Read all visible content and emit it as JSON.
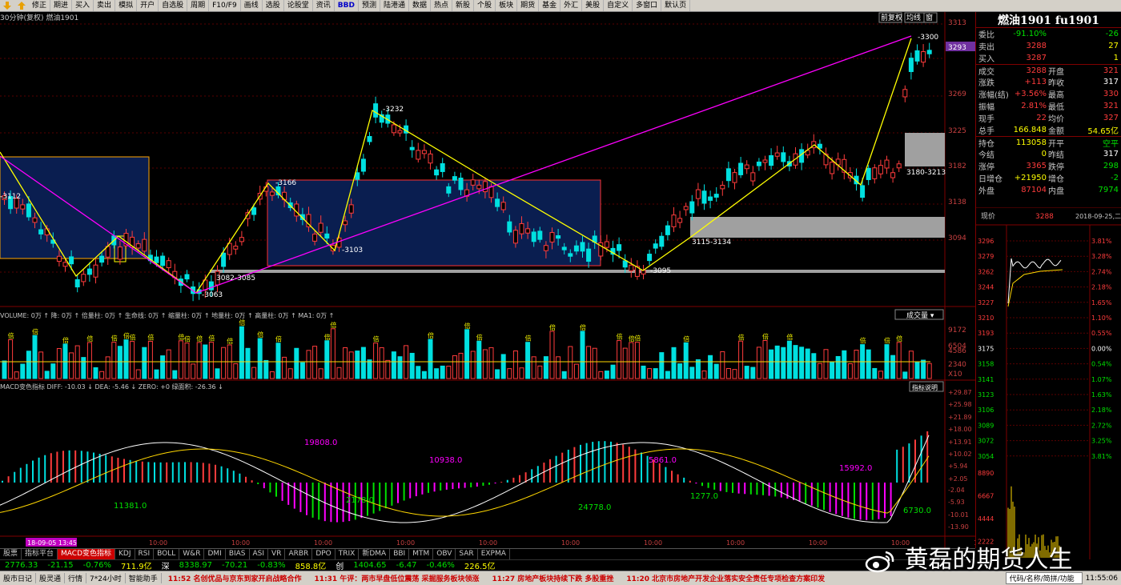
{
  "toolbar": {
    "items": [
      "修正",
      "期进",
      "买入",
      "卖出",
      "模拟",
      "开户",
      "自选股",
      "周期",
      "F10/F9",
      "画线",
      "选股",
      "论股堂",
      "资讯",
      "BBD",
      "预测",
      "陆港通",
      "数据",
      "热点",
      "新股",
      "个股",
      "板块",
      "期货",
      "基金",
      "外汇",
      "美股",
      "自定义",
      "多窗口",
      "默认页"
    ],
    "highlight_index": 13
  },
  "chart_header": {
    "period": "30分钟(复权)",
    "symbol": "燃油1901",
    "buttons": [
      "前复权",
      "均线",
      "窗"
    ]
  },
  "price_labels": {
    "axis": [
      "3313",
      "3293",
      "3269",
      "3225",
      "3182",
      "3138",
      "3094"
    ],
    "current": "3293",
    "peaks": [
      "3300",
      "3232",
      "3166",
      "3112",
      "3103",
      "3063",
      "3095"
    ],
    "zones": [
      "3082-3085",
      "3115-3134",
      "3180-3213"
    ]
  },
  "volume_panel": {
    "legend": "VOLUME: 0万 ↑ 降: 0万 ↑ 倍量柱: 0万 ↑ 生命线: 0万 ↑ 缩量柱: 0万 ↑ 地量柱: 0万 ↑ 高量柱: 0万 ↑ MA1: 0万 ↑",
    "selector": "成交量",
    "axis": [
      "9172",
      "6504",
      "4586",
      "2340",
      "X10"
    ],
    "mark": "倍"
  },
  "macd_panel": {
    "legend": "MACD变色指标  DIFF: -10.03 ↓  DEA: -5.46 ↓  ZERO: +0  绿面积: -26.36 ↓",
    "help": "指标说明",
    "axis": [
      "+29.87",
      "+25.98",
      "+21.89",
      "+18.00",
      "+13.91",
      "+10.02",
      "+5.94",
      "+2.05",
      "-2.04",
      "-5.93",
      "-10.01",
      "-13.90"
    ],
    "areas": [
      "19808.0",
      "10938.0",
      "5861.0",
      "15992.0",
      "11381.0",
      "2178.0",
      "24778.0",
      "1277.0",
      "6730.0"
    ]
  },
  "time_axis": {
    "start": "18-09-05 13:45",
    "ticks": [
      "10:00",
      "10:00",
      "10:00",
      "10:00",
      "10:00",
      "10:00",
      "10:00",
      "10:00",
      "10:00",
      "10:00",
      "10:00",
      "10:00"
    ]
  },
  "quote_panel": {
    "title": "燃油1901 fu1901",
    "rows": [
      {
        "l1": "委比",
        "v1": "-91.10%",
        "c1": "grn",
        "l2": "",
        "v2": "-26",
        "c2": "grn"
      },
      {
        "l1": "卖出",
        "v1": "3288",
        "c1": "red",
        "l2": "",
        "v2": "27",
        "c2": "yel"
      },
      {
        "l1": "买入",
        "v1": "3287",
        "c1": "red",
        "l2": "",
        "v2": "1",
        "c2": "yel"
      },
      {
        "l1": "成交",
        "v1": "3288",
        "c1": "red",
        "l2": "开盘",
        "v2": "321",
        "c2": "red"
      },
      {
        "l1": "涨跌",
        "v1": "+113",
        "c1": "red",
        "l2": "昨收",
        "v2": "317",
        "c2": "wht"
      },
      {
        "l1": "涨幅(结)",
        "v1": "+3.56%",
        "c1": "red",
        "l2": "最高",
        "v2": "330",
        "c2": "red"
      },
      {
        "l1": "振幅",
        "v1": "2.81%",
        "c1": "red",
        "l2": "最低",
        "v2": "321",
        "c2": "red"
      },
      {
        "l1": "现手",
        "v1": "22",
        "c1": "red",
        "l2": "均价",
        "v2": "327",
        "c2": "red"
      },
      {
        "l1": "总手",
        "v1": "166.848",
        "c1": "yel",
        "l2": "金额",
        "v2": "54.65亿",
        "c2": "yel"
      },
      {
        "l1": "持仓",
        "v1": "113058",
        "c1": "yel",
        "l2": "开平",
        "v2": "空平",
        "c2": "grn"
      },
      {
        "l1": "今结",
        "v1": "0",
        "c1": "yel",
        "l2": "昨结",
        "v2": "317",
        "c2": "wht"
      },
      {
        "l1": "涨停",
        "v1": "3365",
        "c1": "red",
        "l2": "跌停",
        "v2": "298",
        "c2": "grn"
      },
      {
        "l1": "日增仓",
        "v1": "+21950",
        "c1": "yel",
        "l2": "增仓",
        "v2": "-2",
        "c2": "grn"
      },
      {
        "l1": "外盘",
        "v1": "87104",
        "c1": "red",
        "l2": "内盘",
        "v2": "7974",
        "c2": "grn"
      }
    ],
    "intraday_label": "现价",
    "intraday_price": "3288",
    "intraday_date": "2018-09-25,二",
    "axis_left": [
      "3296",
      "3279",
      "3262",
      "3244",
      "3227",
      "3210",
      "3193",
      "3175",
      "3158",
      "3141",
      "3123",
      "3106",
      "3089",
      "3072",
      "3054",
      "8890",
      "6667",
      "4444",
      "2222"
    ],
    "axis_right": [
      "3.81%",
      "3.28%",
      "2.74%",
      "2.18%",
      "1.65%",
      "1.10%",
      "0.55%",
      "0.00%",
      "0.54%",
      "1.07%",
      "1.63%",
      "2.18%",
      "2.72%",
      "3.25%",
      "3.81%"
    ]
  },
  "indicator_tabs": [
    "股票",
    "指标平台",
    "MACD变色指标",
    "KDJ",
    "RSI",
    "BOLL",
    "W&R",
    "DMI",
    "BIAS",
    "ASI",
    "VR",
    "ARBR",
    "DPO",
    "TRIX",
    "新DMA",
    "BBI",
    "MTM",
    "OBV",
    "SAR",
    "EXPMA"
  ],
  "index_bar": [
    {
      "t": "2776.33",
      "c": "grn"
    },
    {
      "t": "-21.15",
      "c": "grn"
    },
    {
      "t": "-0.76%",
      "c": "grn"
    },
    {
      "t": "711.9亿",
      "c": "yel"
    },
    {
      "t": "深",
      "c": "wht"
    },
    {
      "t": "8338.97",
      "c": "grn"
    },
    {
      "t": "-70.21",
      "c": "grn"
    },
    {
      "t": "-0.83%",
      "c": "grn"
    },
    {
      "t": "858.8亿",
      "c": "yel"
    },
    {
      "t": "创",
      "c": "wht"
    },
    {
      "t": "1404.65",
      "c": "grn"
    },
    {
      "t": "-6.47",
      "c": "grn"
    },
    {
      "t": "-0.46%",
      "c": "grn"
    },
    {
      "t": "226.5亿",
      "c": "yel"
    }
  ],
  "status_bar": {
    "buttons": [
      "股市日记",
      "股灵通",
      "行情",
      "7*24小时",
      "智能助手"
    ],
    "news": [
      "11:52 名创优品与京东到家开启战略合作",
      "11:31 午评：两市早盘低位震荡 采掘服务板块领涨",
      "11:27 房地产板块持续下跌 多股重挫",
      "11:20 北京市房地产开发企业落实安全责任专项检查方案印发"
    ],
    "search": "代码/名称/简拼/功能",
    "time": "11:55:06"
  },
  "watermark": "黄磊的期货人生"
}
